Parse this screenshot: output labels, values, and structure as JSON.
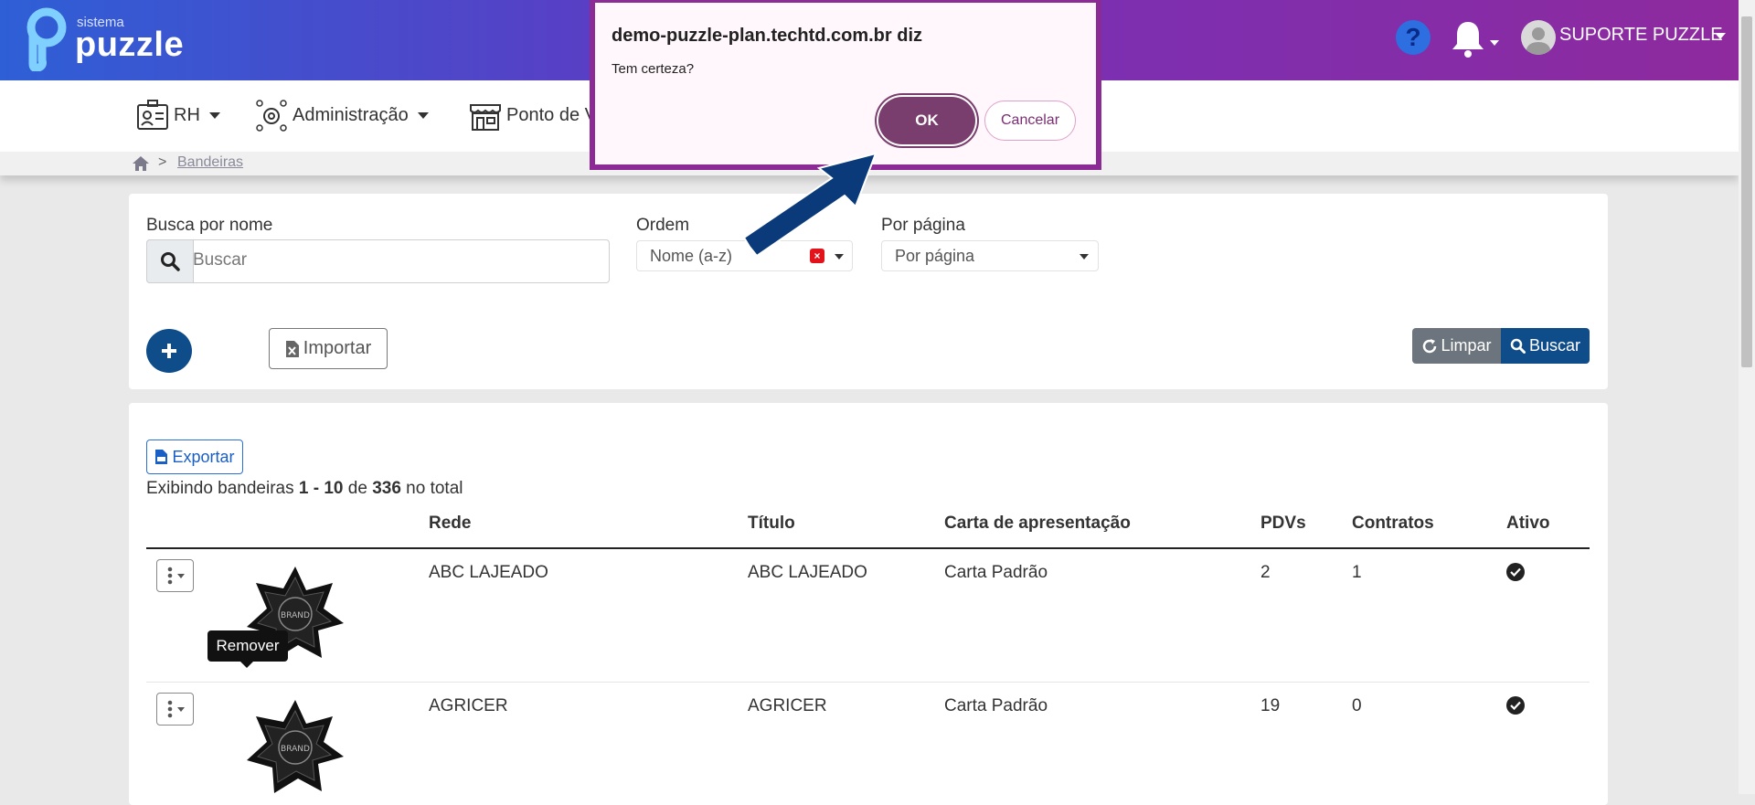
{
  "header": {
    "logo_small": "sistema",
    "logo_big": "puzzle",
    "help_icon": "question-circle-icon",
    "bell_icon": "bell-icon",
    "user_name": "SUPORTE PUZZLE"
  },
  "nav": {
    "items": [
      {
        "label": "RH",
        "icon": "id-card-icon"
      },
      {
        "label": "Administração",
        "icon": "gears-icon"
      },
      {
        "label": "Ponto de V",
        "icon": "store-icon"
      }
    ]
  },
  "breadcrumb": {
    "separator": ">",
    "current": "Bandeiras"
  },
  "filters": {
    "search_label": "Busca por nome",
    "search_placeholder": "Buscar",
    "order_label": "Ordem",
    "order_value": "Nome (a-z)",
    "per_page_label": "Por página",
    "per_page_value": "Por página",
    "import_label": "Importar",
    "clear_label": "Limpar",
    "search_button_label": "Buscar"
  },
  "table": {
    "export_label": "Exportar",
    "count_prefix": "Exibindo bandeiras ",
    "count_range": "1 - 10",
    "count_mid": " de ",
    "count_total": "336",
    "count_suffix": " no total",
    "columns": [
      "Rede",
      "Título",
      "Carta de apresentação",
      "PDVs",
      "Contratos",
      "Ativo"
    ],
    "rows": [
      {
        "rede": "ABC LAJEADO",
        "titulo": "ABC LAJEADO",
        "carta": "Carta Padrão",
        "pdvs": "2",
        "contratos": "1",
        "ativo": true,
        "brand_text": "BRAND"
      },
      {
        "rede": "AGRICER",
        "titulo": "AGRICER",
        "carta": "Carta Padrão",
        "pdvs": "19",
        "contratos": "0",
        "ativo": true,
        "brand_text": "BRAND"
      }
    ],
    "tooltip": "Remover"
  },
  "dialog": {
    "title": "demo-puzzle-plan.techtd.com.br diz",
    "message": "Tem certeza?",
    "ok_label": "OK",
    "cancel_label": "Cancelar"
  },
  "colors": {
    "header_gradient_start": "#2e5fd6",
    "header_gradient_end": "#8e2a9e",
    "primary": "#0f4c8a",
    "dialog_border": "#8c2b96",
    "ok_button": "#7a3e6e"
  }
}
